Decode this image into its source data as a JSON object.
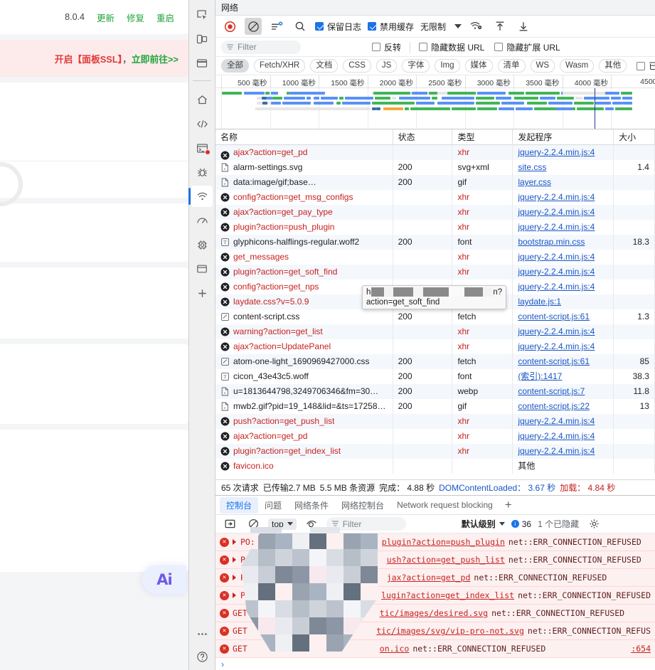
{
  "page": {
    "version": "8.0.4",
    "links": [
      "更新",
      "修复",
      "重启"
    ],
    "alert_prefix": "开启【面板SSL】",
    "alert_comma": "，",
    "alert_link": "立即前往>>",
    "ai_button": "Ai"
  },
  "devtools": {
    "panel_title": "网络",
    "toolbar": {
      "record_icon": "record-icon",
      "clear_icon": "clear-icon",
      "filter_toggle_icon": "filter-settings-icon",
      "search_icon": "search-icon",
      "preserve_log": "保留日志",
      "disable_cache": "禁用缓存",
      "throttle_value": "无限制",
      "wifi_icon": "network-conditions-icon",
      "import_icon": "import-har-icon",
      "export_icon": "export-har-icon"
    },
    "filterbar": {
      "filter_placeholder": "Filter",
      "invert": "反转",
      "hide_data_urls": "隐藏数据 URL",
      "hide_ext_urls": "隐藏扩展 URL"
    },
    "types": [
      "全部",
      "Fetch/XHR",
      "文档",
      "CSS",
      "JS",
      "字体",
      "Img",
      "媒体",
      "清单",
      "WS",
      "Wasm",
      "其他"
    ],
    "blocked_cookies_label": "已阻止的响应 Coo",
    "overview": {
      "ticks": [
        "500 毫秒",
        "1000 毫秒",
        "1500 毫秒",
        "2000 毫秒",
        "2500 毫秒",
        "3000 毫秒",
        "3500 毫秒",
        "4000 毫秒",
        "4500"
      ]
    },
    "columns": [
      "名称",
      "状态",
      "类型",
      "发起程序",
      "大小"
    ],
    "tooltip": {
      "line1_head": "h",
      "line1_tail": "n?",
      "line2": "action=get_soft_find"
    },
    "rows": [
      {
        "name": "ajax?action=get_pd",
        "status": "",
        "type": "xhr",
        "initiator": "jquery-2.2.4.min.js:4",
        "size": "",
        "error": true,
        "icon": "blocked-icon",
        "clipped": true
      },
      {
        "name": "alarm-settings.svg",
        "status": "200",
        "type": "svg+xml",
        "initiator": "site.css",
        "size": "1.4",
        "error": false,
        "icon": "image-file-icon"
      },
      {
        "name": "data:image/gif;base…",
        "status": "200",
        "type": "gif",
        "initiator": "layer.css",
        "size": "",
        "error": false,
        "icon": "image-file-icon"
      },
      {
        "name": "config?action=get_msg_configs",
        "status": "",
        "type": "xhr",
        "initiator": "jquery-2.2.4.min.js:4",
        "size": "",
        "error": true,
        "icon": "blocked-icon"
      },
      {
        "name": "ajax?action=get_pay_type",
        "status": "",
        "type": "xhr",
        "initiator": "jquery-2.2.4.min.js:4",
        "size": "",
        "error": true,
        "icon": "blocked-icon"
      },
      {
        "name": "plugin?action=push_plugin",
        "status": "",
        "type": "xhr",
        "initiator": "jquery-2.2.4.min.js:4",
        "size": "",
        "error": true,
        "icon": "blocked-icon"
      },
      {
        "name": "glyphicons-halflings-regular.woff2",
        "status": "200",
        "type": "font",
        "initiator": "bootstrap.min.css",
        "size": "18.3",
        "error": false,
        "icon": "font-file-icon"
      },
      {
        "name": "get_messages",
        "status": "",
        "type": "xhr",
        "initiator": "jquery-2.2.4.min.js:4",
        "size": "",
        "error": true,
        "icon": "blocked-icon"
      },
      {
        "name": "plugin?action=get_soft_find",
        "status": "",
        "type": "xhr",
        "initiator": "jquery-2.2.4.min.js:4",
        "size": "",
        "error": true,
        "icon": "blocked-icon"
      },
      {
        "name": "config?action=get_nps",
        "status": "",
        "type": "",
        "initiator": "jquery-2.2.4.min.js:4",
        "size": "",
        "error": true,
        "icon": "blocked-icon"
      },
      {
        "name": "laydate.css?v=5.0.9",
        "status": "",
        "type": "",
        "initiator": "laydate.js:1",
        "size": "",
        "error": true,
        "icon": "blocked-icon"
      },
      {
        "name": "content-script.css",
        "status": "200",
        "type": "fetch",
        "initiator": "content-script.js:61",
        "size": "1.3",
        "error": false,
        "icon": "script-file-icon"
      },
      {
        "name": "warning?action=get_list",
        "status": "",
        "type": "xhr",
        "initiator": "jquery-2.2.4.min.js:4",
        "size": "",
        "error": true,
        "icon": "blocked-icon"
      },
      {
        "name": "ajax?action=UpdatePanel",
        "status": "",
        "type": "xhr",
        "initiator": "jquery-2.2.4.min.js:4",
        "size": "",
        "error": true,
        "icon": "blocked-icon"
      },
      {
        "name": "atom-one-light_1690969427000.css",
        "status": "200",
        "type": "fetch",
        "initiator": "content-script.js:61",
        "size": "85",
        "error": false,
        "icon": "script-file-icon"
      },
      {
        "name": "cicon_43e43c5.woff",
        "status": "200",
        "type": "font",
        "initiator": "(索引):1417",
        "size": "38.3",
        "error": false,
        "icon": "font-file-icon"
      },
      {
        "name": "u=1813644798,3249706346&fm=30…",
        "status": "200",
        "type": "webp",
        "initiator": "content-script.js:7",
        "size": "11.8",
        "error": false,
        "icon": "image-file-icon"
      },
      {
        "name": "mwb2.gif?pid=19_148&lid=&ts=17258…",
        "status": "200",
        "type": "gif",
        "initiator": "content-script.js:22",
        "size": "13",
        "error": false,
        "icon": "image-file-icon"
      },
      {
        "name": "push?action=get_push_list",
        "status": "",
        "type": "xhr",
        "initiator": "jquery-2.2.4.min.js:4",
        "size": "",
        "error": true,
        "icon": "blocked-icon"
      },
      {
        "name": "ajax?action=get_pd",
        "status": "",
        "type": "xhr",
        "initiator": "jquery-2.2.4.min.js:4",
        "size": "",
        "error": true,
        "icon": "blocked-icon"
      },
      {
        "name": "plugin?action=get_index_list",
        "status": "",
        "type": "xhr",
        "initiator": "jquery-2.2.4.min.js:4",
        "size": "",
        "error": true,
        "icon": "blocked-icon"
      },
      {
        "name": "favicon.ico",
        "status": "",
        "type": "",
        "initiator": "其他",
        "size": "",
        "error": true,
        "icon": "blocked-icon",
        "initiator_plain": true
      }
    ],
    "status_bar": {
      "requests": "65 次请求",
      "transferred": "已传输2.7 MB",
      "resources": "5.5 MB 条资源",
      "finish": "完成： 4.88 秒",
      "dcl": "DOMContentLoaded： 3.67 秒",
      "load": "加载： 4.84 秒"
    },
    "drawer": {
      "tabs": [
        "控制台",
        "问题",
        "网络条件",
        "网络控制台",
        "Network request blocking"
      ],
      "add_tab": "+",
      "console_toolbar": {
        "sidebar_icon": "console-sidebar-icon",
        "clear_icon": "clear-console-icon",
        "context": "top",
        "eye_icon": "live-expression-icon",
        "filter_placeholder": "Filter",
        "level": "默认级别",
        "error_count": "36",
        "hidden": "1 个已隐藏",
        "settings_icon": "gear-icon"
      },
      "logs": [
        {
          "method": "PO:",
          "url_tail": "plugin?action=push_plugin",
          "err": "net::ERR_CONNECTION_REFUSED",
          "expandable": true,
          "right": "",
          "clipped": true
        },
        {
          "method": "POST",
          "url_tail": "ush?action=get_push_list",
          "err": "net::ERR_CONNECTION_REFUSED",
          "expandable": true,
          "right": ""
        },
        {
          "method": "PU_.",
          "url_tail": "jax?action=get_pd",
          "err": "net::ERR_CONNECTION_REFUSED",
          "expandable": true,
          "right": ""
        },
        {
          "method": "POST",
          "url_tail": "lugin?action=get_index_list",
          "err": "net::ERR_CONNECTION_REFUSED",
          "expandable": true,
          "right": ""
        },
        {
          "method": "GET",
          "url_tail": "tic/images/desired.svg",
          "err": "net::ERR_CONNECTION_REFUSED",
          "expandable": false,
          "right": ""
        },
        {
          "method": "GET",
          "url_tail": "tic/images/svg/vip-pro-not.svg",
          "err": "net::ERR_CONNECTION_REFUS",
          "expandable": false,
          "right": ""
        },
        {
          "method": "GET",
          "url_tail": "on.ico",
          "err": "net::ERR_CONNECTION_REFUSED",
          "expandable": false,
          "right": ":654"
        }
      ]
    }
  },
  "activity_bar": {
    "items": [
      {
        "icon": "inspect-element-icon",
        "selected": false
      },
      {
        "icon": "device-toolbar-icon",
        "selected": false
      },
      {
        "icon": "panel-layout-icon",
        "selected": false
      },
      {
        "icon": "home-icon",
        "selected": false
      },
      {
        "icon": "elements-code-icon",
        "selected": false
      },
      {
        "icon": "console-terminal-icon",
        "selected": false,
        "badge": true
      },
      {
        "icon": "debug-bug-icon",
        "selected": false
      },
      {
        "icon": "network-wifi-icon",
        "selected": true
      },
      {
        "icon": "performance-gauge-icon",
        "selected": false
      },
      {
        "icon": "memory-chip-icon",
        "selected": false
      },
      {
        "icon": "application-window-icon",
        "selected": false
      },
      {
        "icon": "add-panel-icon",
        "selected": false
      }
    ],
    "bottom": [
      {
        "icon": "more-options-icon"
      },
      {
        "icon": "help-question-icon"
      }
    ]
  },
  "colors": {
    "accent_blue": "#1a73e8",
    "error_red": "#c5221f",
    "link_blue": "#1a56c4",
    "green": "#20a53a",
    "waterfall_green": "#41b658",
    "waterfall_blue": "#5a91f5"
  }
}
